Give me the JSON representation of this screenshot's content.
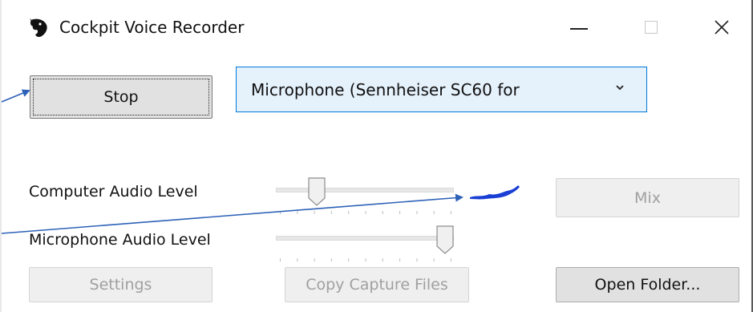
{
  "window": {
    "title": "Cockpit Voice Recorder",
    "minimize_icon": "minimize-icon",
    "maximize_icon": "maximize-icon",
    "close_icon": "close-icon"
  },
  "controls": {
    "stop_label": "Stop",
    "device_selected": "Microphone (Sennheiser SC60 for",
    "computer_audio_label": "Computer Audio Level",
    "microphone_audio_label": "Microphone Audio Level",
    "computer_audio_level": 0.2,
    "microphone_audio_level": 1.0,
    "mix_label": "Mix",
    "settings_label": "Settings",
    "copy_capture_label": "Copy Capture Files",
    "open_folder_label": "Open Folder..."
  },
  "annotation_color": "#2e62b8"
}
